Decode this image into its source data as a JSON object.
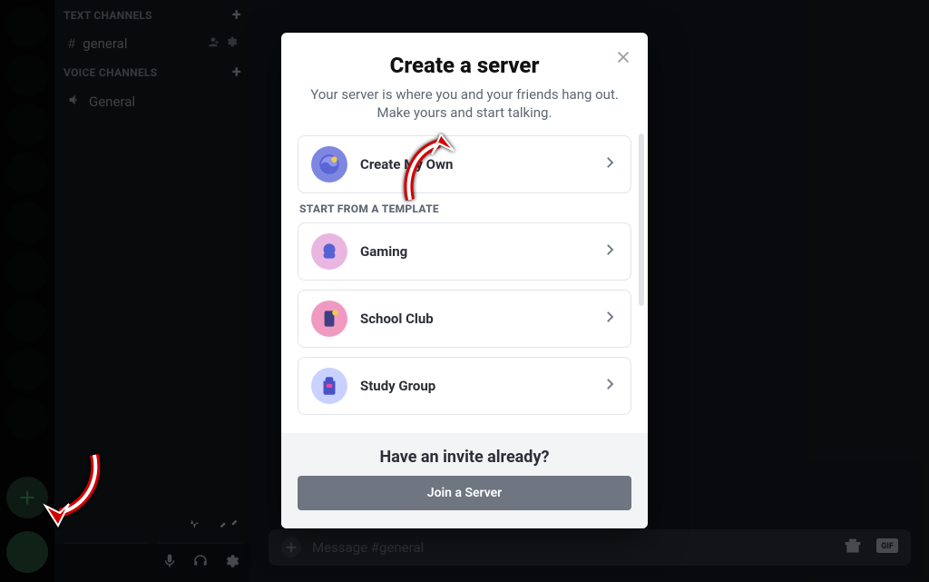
{
  "channels": {
    "text_header": "TEXT CHANNELS",
    "text_ch": "general",
    "voice_header": "VOICE CHANNELS",
    "voice_ch": "General",
    "video_btn": "Video",
    "screen_btn": "Screen"
  },
  "chat": {
    "placeholder": "Message #general"
  },
  "modal": {
    "title": "Create a server",
    "subtitle": "Your server is where you and your friends hang out. Make yours and start talking.",
    "create_own": "Create My Own",
    "template_label": "START FROM A TEMPLATE",
    "opt_gaming": "Gaming",
    "opt_school": "School Club",
    "opt_study": "Study Group",
    "footer_title": "Have an invite already?",
    "join_btn": "Join a Server"
  }
}
